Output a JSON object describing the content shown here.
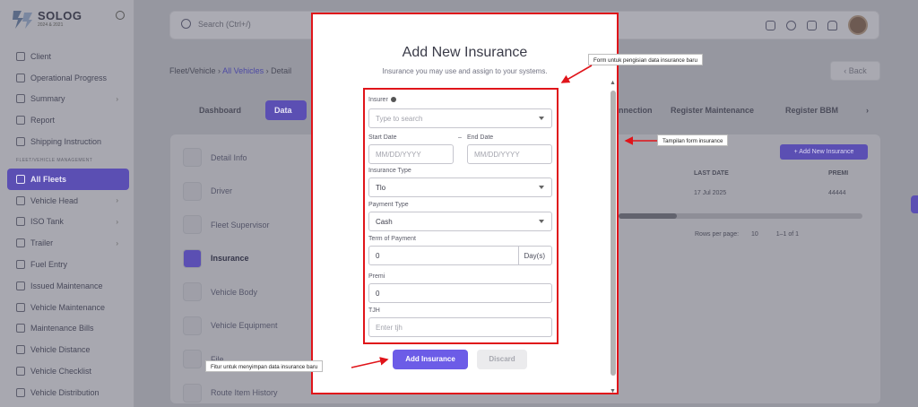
{
  "app": {
    "logo_title": "SOLOG",
    "logo_sub": "2024 & 2021",
    "sidebar": {
      "items_top": [
        {
          "label": "Client"
        },
        {
          "label": "Operational Progress"
        },
        {
          "label": "Summary",
          "chevron": true
        },
        {
          "label": "Report"
        },
        {
          "label": "Shipping Instruction"
        }
      ],
      "section_label": "FLEET/VEHICLE MANAGEMENT",
      "items_fleet": [
        {
          "label": "All Fleets",
          "active": true
        },
        {
          "label": "Vehicle Head",
          "chevron": true
        },
        {
          "label": "ISO Tank",
          "chevron": true
        },
        {
          "label": "Trailer",
          "chevron": true
        },
        {
          "label": "Fuel Entry"
        },
        {
          "label": "Issued Maintenance"
        },
        {
          "label": "Vehicle Maintenance"
        },
        {
          "label": "Maintenance Bills"
        },
        {
          "label": "Vehicle Distance"
        },
        {
          "label": "Vehicle Checklist"
        },
        {
          "label": "Vehicle Distribution"
        }
      ]
    },
    "search_placeholder": "Search (Ctrl+/)",
    "breadcrumb": {
      "root": "Fleet/Vehicle",
      "sep1": "›",
      "link": "All Vehicles",
      "sep2": "›",
      "current": "Detail"
    },
    "back_label": "Back",
    "tabs": [
      "Dashboard",
      "Data",
      "Connection",
      "Register Maintenance",
      "Register BBM",
      "›"
    ],
    "left_menu": [
      "Detail Info",
      "Driver",
      "Fleet Supervisor",
      "Insurance",
      "Vehicle Body",
      "Vehicle Equipment",
      "File",
      "Route Item History"
    ],
    "add_new_label": "+ Add New Insurance",
    "table": {
      "headers": [
        "LAST DATE",
        "PREMI"
      ],
      "row": [
        "17 Jul 2025",
        "44444"
      ]
    },
    "pager": {
      "rows_label": "Rows per page:",
      "rows_value": "10",
      "range": "1–1 of 1"
    }
  },
  "modal": {
    "title": "Add New Insurance",
    "subtitle": "Insurance you may use and assign to your systems.",
    "fields": {
      "insurer": {
        "label": "Insurer",
        "placeholder": "Type to search"
      },
      "start_date": {
        "label": "Start Date",
        "placeholder": "MM/DD/YYYY"
      },
      "end_date_sep": "–",
      "end_date": {
        "label": "End Date",
        "placeholder": "MM/DD/YYYY"
      },
      "insurance_type": {
        "label": "Insurance Type",
        "value": "Tlo"
      },
      "payment_type": {
        "label": "Payment Type",
        "value": "Cash"
      },
      "term_of_payment": {
        "label": "Term of Payment",
        "value": "0",
        "suffix": "Day(s)"
      },
      "premi": {
        "label": "Premi",
        "value": "0"
      },
      "tjh": {
        "label": "TJH",
        "placeholder": "Enter tjh"
      }
    },
    "submit_label": "Add Insurance",
    "discard_label": "Discard"
  },
  "annotations": {
    "form_note": "Form untuk pengisian data insurance baru",
    "display_note": "Tampilan form insurance",
    "save_note": "Fitur untuk menyimpan data insurance baru"
  },
  "colors": {
    "accent": "#6c5ce7",
    "annotation_red": "#e0141a"
  }
}
